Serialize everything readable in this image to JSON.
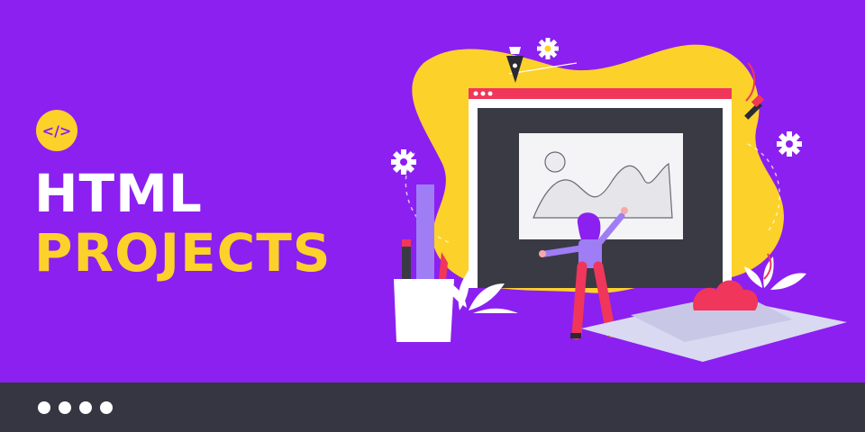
{
  "badge": {
    "text": "</>"
  },
  "heading": {
    "line1": "HTML",
    "line2": "PROJECTS"
  },
  "footer": {
    "dots": 4
  },
  "colors": {
    "background": "#8b20f0",
    "yellow": "#fcd12a",
    "footer": "#363642",
    "accent_red": "#f0365a",
    "screen_dark": "#3a3a45"
  },
  "icons": [
    "code-icon",
    "gear-icon",
    "pen-nib-icon",
    "dropper-icon",
    "pencil-icon",
    "ruler-icon"
  ]
}
